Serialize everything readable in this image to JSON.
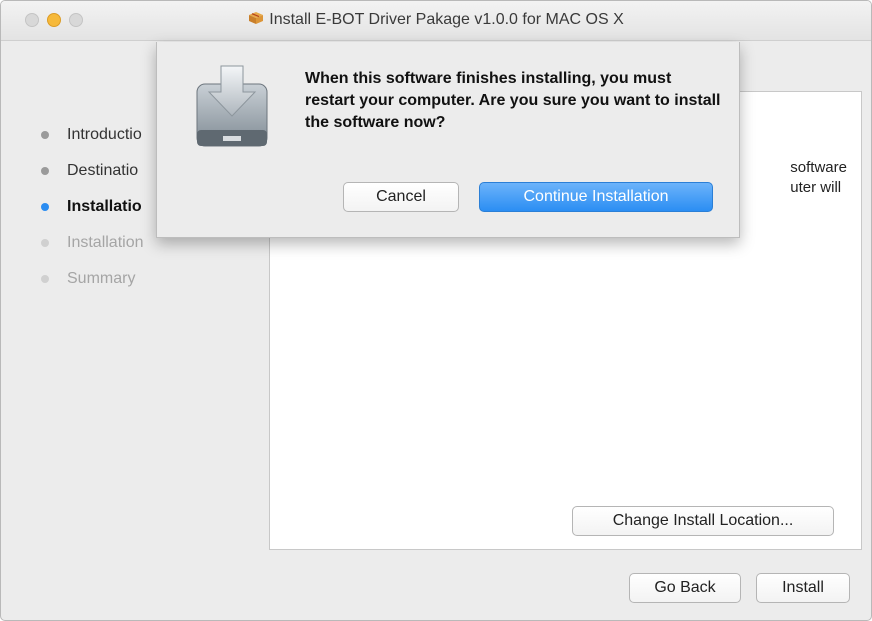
{
  "window": {
    "title": "Install E-BOT Driver Pakage v1.0.0 for MAC OS X",
    "accent_color": "#2a8cf1"
  },
  "sidebar": {
    "steps": [
      {
        "label": "Introductio",
        "state": "done"
      },
      {
        "label": "Destinatio",
        "state": "done"
      },
      {
        "label": "Installatio",
        "state": "current"
      },
      {
        "label": "Installation",
        "state": "future"
      },
      {
        "label": "Summary",
        "state": "future"
      }
    ]
  },
  "content": {
    "partial_text_line1": "software",
    "partial_text_line2": "uter will",
    "change_location_button": "Change Install Location..."
  },
  "footer": {
    "go_back_button": "Go Back",
    "install_button": "Install"
  },
  "dialog": {
    "icon": "installer-disk-icon",
    "message": "When this software finishes installing, you must restart your computer. Are you sure you want to install the software now?",
    "cancel_button": "Cancel",
    "continue_button": "Continue Installation"
  }
}
